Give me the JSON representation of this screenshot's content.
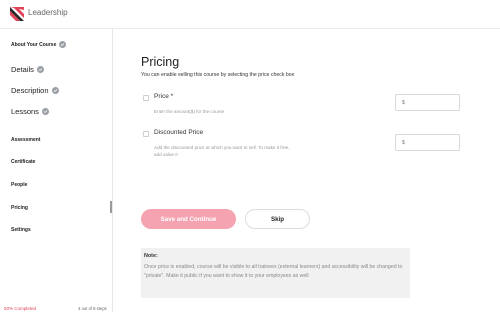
{
  "app": {
    "title": "Leadership"
  },
  "sidebar": {
    "items": [
      {
        "label": "About Your Course",
        "checked": true
      },
      {
        "label": "Details",
        "checked": true
      },
      {
        "label": "Description",
        "checked": true
      },
      {
        "label": "Lessons",
        "checked": true
      },
      {
        "label": "Assessment",
        "checked": false
      },
      {
        "label": "Certificate",
        "checked": false
      },
      {
        "label": "People",
        "checked": false
      },
      {
        "label": "Pricing",
        "checked": false,
        "active": true
      },
      {
        "label": "Settings",
        "checked": false
      }
    ],
    "progress_label": "50% Completed",
    "progress_percent": 50,
    "steps_label": "4 out of 8 steps"
  },
  "pricing": {
    "title": "Pricing",
    "subtitle": "You can enable selling this course by selecting the price check box",
    "price": {
      "label": "Price *",
      "help": "Enter the amount($) for the course",
      "placeholder": "$"
    },
    "discounted": {
      "label": "Discounted Price",
      "help": "Add the discounted price at which you want to sell. To make it free, add value 0",
      "placeholder": "$"
    },
    "save_button": "Save and Continue",
    "skip_button": "Skip",
    "note": {
      "title": "Note:",
      "body": "Once price is enabled, course will be visible to all trainees (external learners) and accessibility will be changed to \"private\". Make it public if you want to show it to your employees as well"
    }
  },
  "colors": {
    "accent": "#f5a3b0",
    "progress_text": "#e0435a",
    "check": "#9a9ea5"
  }
}
